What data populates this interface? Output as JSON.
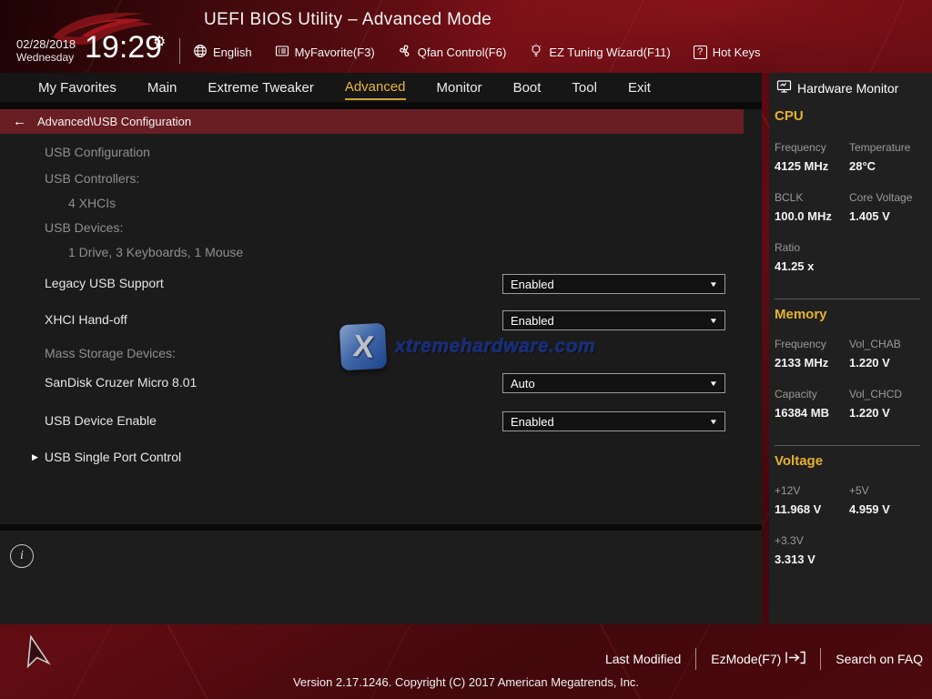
{
  "colors": {
    "accent_gold": "#e8b63c",
    "breadcrumb_maroon": "#691e24",
    "panel_dark": "#1b1b1b",
    "header_red": "#6b0e14",
    "value_white": "#f4f4f4",
    "label_gray": "#8f8f8f"
  },
  "header": {
    "title": "UEFI BIOS Utility – Advanced Mode",
    "date": "02/28/2018",
    "weekday": "Wednesday",
    "time": "19:29",
    "toolbar": [
      {
        "icon": "globe-icon",
        "label": "English"
      },
      {
        "icon": "myfavorite-icon",
        "label": "MyFavorite(F3)"
      },
      {
        "icon": "qfan-icon",
        "label": "Qfan Control(F6)"
      },
      {
        "icon": "wizard-icon",
        "label": "EZ Tuning Wizard(F11)"
      },
      {
        "icon": "hotkeys-icon",
        "label": "Hot Keys",
        "badge": "?"
      }
    ]
  },
  "nav": {
    "tabs": [
      "My Favorites",
      "Main",
      "Extreme Tweaker",
      "Advanced",
      "Monitor",
      "Boot",
      "Tool",
      "Exit"
    ],
    "active_tab": "Advanced"
  },
  "breadcrumb": {
    "back_arrow": "←",
    "path": "Advanced\\USB Configuration"
  },
  "content": {
    "info_lines": [
      {
        "text": "USB Configuration",
        "indent": 0
      },
      {
        "text": "USB Controllers:",
        "indent": 0
      },
      {
        "text": "4 XHCIs",
        "indent": 1
      },
      {
        "text": "USB Devices:",
        "indent": 0
      },
      {
        "text": "1 Drive, 3 Keyboards, 1 Mouse",
        "indent": 1
      }
    ],
    "settings": [
      {
        "label": "Legacy USB Support",
        "value": "Enabled"
      },
      {
        "label": "XHCI Hand-off",
        "value": "Enabled"
      },
      {
        "label": "SanDisk Cruzer Micro 8.01",
        "value": "Auto"
      },
      {
        "label": "USB Device Enable",
        "value": "Enabled"
      }
    ],
    "section_label": "Mass Storage Devices:",
    "submenu_label": "USB Single Port Control",
    "dropdown_caret": "▼",
    "submenu_arrow": "▶"
  },
  "watermark": {
    "x": "X",
    "text": "xtremehardware.com"
  },
  "hardware_monitor": {
    "title": "Hardware Monitor",
    "sections": [
      {
        "heading": "CPU",
        "pairs": [
          {
            "label": "Frequency",
            "value": "4125 MHz"
          },
          {
            "label": "Temperature",
            "value": "28°C"
          },
          {
            "label": "BCLK",
            "value": "100.0 MHz"
          },
          {
            "label": "Core Voltage",
            "value": "1.405 V"
          },
          {
            "label": "Ratio",
            "value": "41.25 x"
          }
        ]
      },
      {
        "heading": "Memory",
        "pairs": [
          {
            "label": "Frequency",
            "value": "2133 MHz"
          },
          {
            "label": "Vol_CHAB",
            "value": "1.220 V"
          },
          {
            "label": "Capacity",
            "value": "16384 MB"
          },
          {
            "label": "Vol_CHCD",
            "value": "1.220 V"
          }
        ]
      },
      {
        "heading": "Voltage",
        "pairs": [
          {
            "label": "+12V",
            "value": "11.968 V"
          },
          {
            "label": "+5V",
            "value": "4.959 V"
          },
          {
            "label": "+3.3V",
            "value": "3.313 V"
          }
        ]
      }
    ]
  },
  "footer": {
    "items": [
      "Last Modified",
      "EzMode(F7)",
      "Search on FAQ"
    ],
    "info_symbol": "i",
    "version": "Version 2.17.1246. Copyright (C) 2017 American Megatrends, Inc."
  }
}
